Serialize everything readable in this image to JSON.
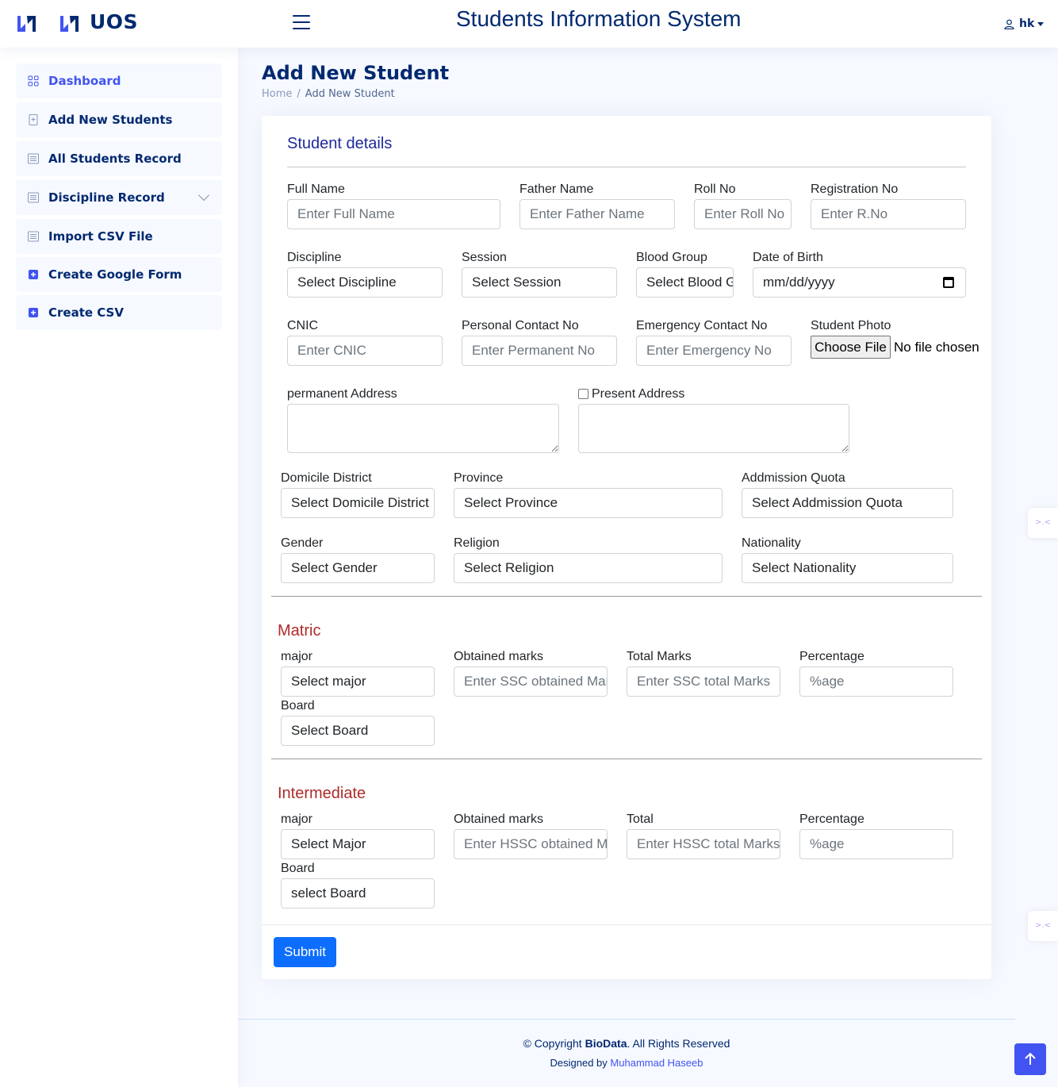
{
  "header": {
    "brand": "UOS",
    "app_title": "Students Information System",
    "user": "hk"
  },
  "sidebar": {
    "items": [
      {
        "label": "Dashboard",
        "icon": "grid-icon"
      },
      {
        "label": "Add New Students",
        "icon": "document-plus-icon"
      },
      {
        "label": "All Students Record",
        "icon": "list-icon"
      },
      {
        "label": "Discipline Record",
        "icon": "list-icon"
      },
      {
        "label": "Import CSV File",
        "icon": "list-icon"
      },
      {
        "label": "Create Google Form",
        "icon": "plus-square-icon"
      },
      {
        "label": "Create CSV",
        "icon": "plus-square-icon"
      }
    ]
  },
  "page": {
    "title": "Add New Student",
    "breadcrumb": [
      "Home",
      "/",
      "Add New Student"
    ]
  },
  "form": {
    "section_title": "Student details",
    "full_name": {
      "label": "Full Name",
      "placeholder": "Enter Full Name"
    },
    "father_name": {
      "label": "Father Name",
      "placeholder": "Enter Father Name"
    },
    "roll_no": {
      "label": "Roll No",
      "placeholder": "Enter Roll No"
    },
    "reg_no": {
      "label": "Registration No",
      "placeholder": "Enter R.No"
    },
    "discipline": {
      "label": "Discipline",
      "value": "Select Discipline"
    },
    "session": {
      "label": "Session",
      "value": "Select Session"
    },
    "blood_group": {
      "label": "Blood Group",
      "value": "Select Blood Group"
    },
    "dob": {
      "label": "Date of Birth",
      "value": "mm/dd/yyyy"
    },
    "cnic": {
      "label": "CNIC",
      "placeholder": "Enter CNIC"
    },
    "personal_contact": {
      "label": "Personal Contact No",
      "placeholder": "Enter Permanent No"
    },
    "emergency_contact": {
      "label": "Emergency Contact No",
      "placeholder": "Enter Emergency No"
    },
    "photo": {
      "label": "Student Photo",
      "button": "Choose File",
      "status": "No file chosen"
    },
    "permanent_address": {
      "label": "permanent Address"
    },
    "present_address": {
      "label": "Present Address"
    },
    "domicile": {
      "label": "Domicile District",
      "value": "Select Domicile District"
    },
    "province": {
      "label": "Province",
      "value": "Select Province"
    },
    "quota": {
      "label": "Addmission Quota",
      "value": "Select Addmission Quota"
    },
    "gender": {
      "label": "Gender",
      "value": "Select Gender"
    },
    "religion": {
      "label": "Religion",
      "value": "Select Religion"
    },
    "nationality": {
      "label": "Nationality",
      "value": "Select Nationality"
    }
  },
  "matric": {
    "heading": "Matric",
    "major": {
      "label": "major",
      "value": "Select major"
    },
    "obtained": {
      "label": "Obtained marks",
      "placeholder": "Enter SSC obtained Marks"
    },
    "total": {
      "label": "Total Marks",
      "placeholder": "Enter SSC total Marks"
    },
    "percentage": {
      "label": "Percentage",
      "placeholder": "%age"
    },
    "board": {
      "label": "Board",
      "value": "Select Board"
    }
  },
  "intermediate": {
    "heading": "Intermediate",
    "major": {
      "label": "major",
      "value": "Select Major"
    },
    "obtained": {
      "label": "Obtained marks",
      "placeholder": "Enter HSSC obtained Marks"
    },
    "total": {
      "label": "Total",
      "placeholder": "Enter HSSC total Marks"
    },
    "percentage": {
      "label": "Percentage",
      "placeholder": "%age"
    },
    "board": {
      "label": "Board",
      "value": "select Board"
    }
  },
  "submit_label": "Submit",
  "footer": {
    "copyright_prefix": "© Copyright",
    "brand": "BioData",
    "copyright_suffix": ". All Rights Reserved",
    "designed_prefix": "Designed by",
    "designer": "Muhammad Haseeb"
  },
  "colors": {
    "primary": "#4154f1",
    "navy": "#012970",
    "button": "#0d6efd",
    "section": "#b02a2a"
  }
}
